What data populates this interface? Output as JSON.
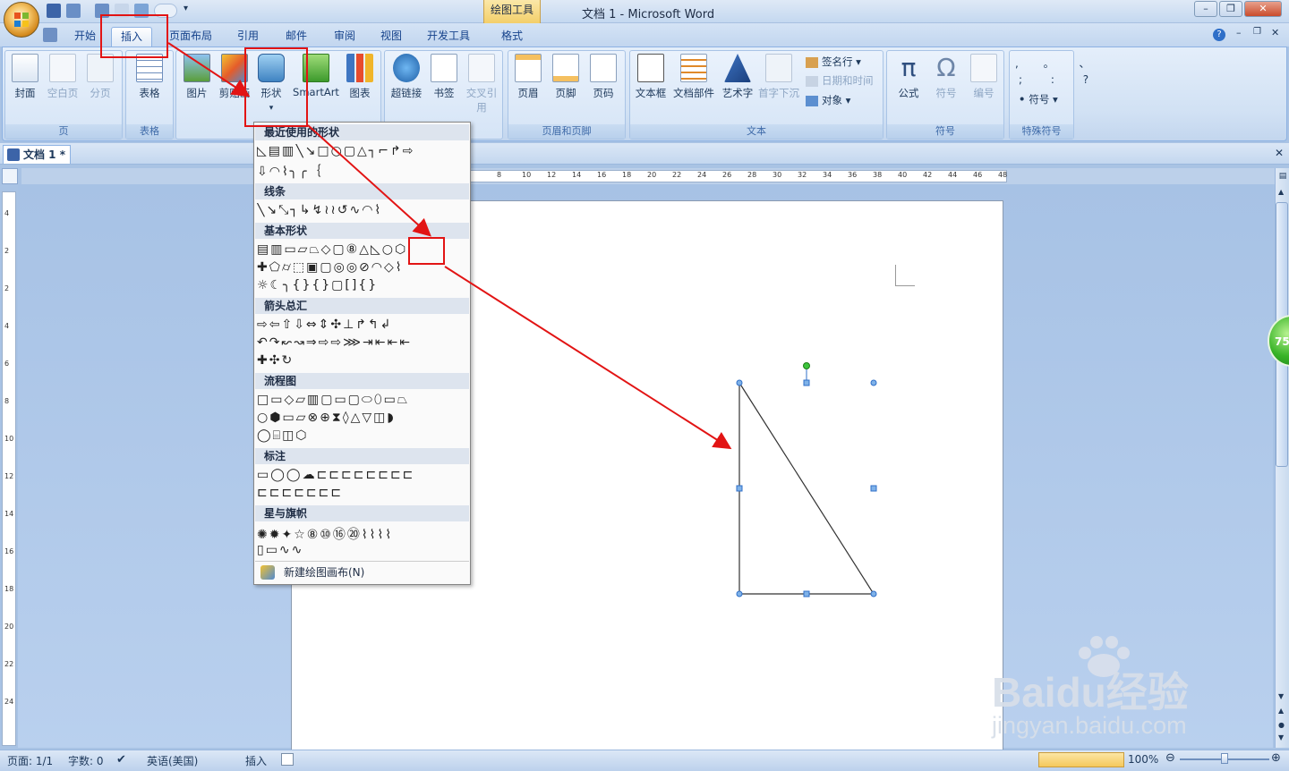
{
  "titlebar": {
    "drawing_tools": "绘图工具",
    "title": "文档 1 - Microsoft Word",
    "minimize": "–",
    "restore": "❐",
    "close": "✕"
  },
  "tabs": [
    "开始",
    "插入",
    "页面布局",
    "引用",
    "邮件",
    "审阅",
    "视图",
    "开发工具",
    "格式"
  ],
  "ribbon": {
    "pages_group": {
      "label": "页",
      "buttons": [
        "封面",
        "空白页",
        "分页"
      ]
    },
    "table_group": {
      "label": "表格",
      "buttons": [
        "表格"
      ]
    },
    "illus_group": {
      "buttons": [
        "图片",
        "剪贴画",
        "形状",
        "SmartArt",
        "图表"
      ]
    },
    "links_group": {
      "buttons": [
        "超链接",
        "书签",
        "交叉引用"
      ]
    },
    "hf_group": {
      "label": "页眉和页脚",
      "buttons": [
        "页眉",
        "页脚",
        "页码"
      ]
    },
    "text_group": {
      "label": "文本",
      "buttons": [
        "文本框",
        "文档部件",
        "艺术字",
        "首字下沉"
      ],
      "small": [
        "签名行 ▾",
        "日期和时间",
        "对象 ▾"
      ]
    },
    "symbols_group": {
      "label": "符号",
      "buttons": [
        "公式",
        "符号",
        "编号"
      ]
    },
    "special_group": {
      "label": "特殊符号",
      "symbols_row1": ", 。 、",
      "symbols_row2": "; : ?",
      "button": "符号 ▾"
    }
  },
  "doc_tab": "文档 1 *",
  "ruler_numbers": [
    "8",
    "10",
    "12",
    "14",
    "16",
    "18",
    "20",
    "22",
    "24",
    "26",
    "28",
    "30",
    "32",
    "34",
    "36",
    "38",
    "40",
    "42",
    "44",
    "46",
    "48"
  ],
  "vruler_numbers": [
    "4",
    "2",
    "2",
    "4",
    "6",
    "8",
    "10",
    "12",
    "14",
    "16",
    "18",
    "20",
    "22",
    "24"
  ],
  "shapes_menu": {
    "recent": "最近使用的形状",
    "lines": "线条",
    "basic": "基本形状",
    "arrows": "箭头总汇",
    "flowchart": "流程图",
    "callouts": "标注",
    "stars": "星与旗帜",
    "new_canvas": "新建绘图画布(N)"
  },
  "status": {
    "page": "页面: 1/1",
    "words": "字数: 0",
    "language": "英语(美国)",
    "mode": "插入",
    "zoom": "100%"
  },
  "green_ball": "75",
  "watermark": {
    "brand": "Baidu经验",
    "url": "jingyan.baidu.com"
  }
}
